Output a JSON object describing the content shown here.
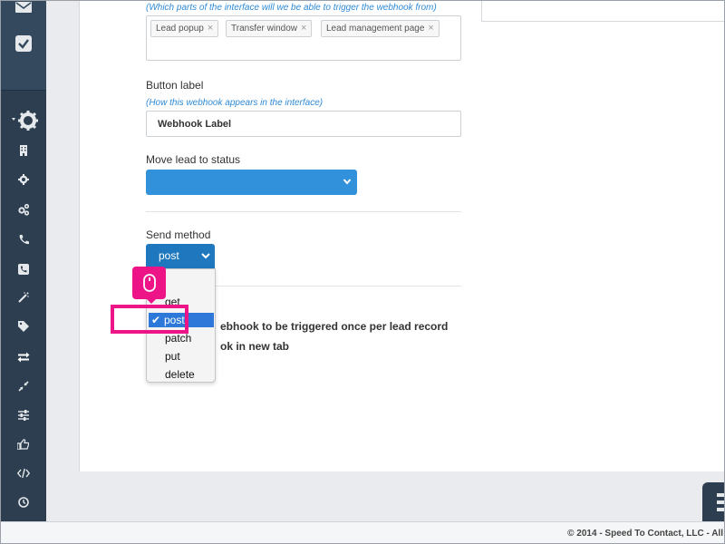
{
  "colors": {
    "sidebar": "#2c3e50",
    "accent": "#3191da",
    "highlight": "#ec1486"
  },
  "sidebar": {
    "icons": [
      "envelope-icon",
      "checkbox-icon",
      "gear-icon",
      "building-icon",
      "cog-icon",
      "cogs-icon",
      "phone-icon",
      "phone-square-icon",
      "magic-wand-icon",
      "tag-icon",
      "exchange-icon",
      "compress-icon",
      "sliders-icon",
      "thumbs-up-icon",
      "code-icon",
      "clock-icon"
    ]
  },
  "form": {
    "trigger_hint": "(Which parts of the interface will we be able to trigger the webhook from)",
    "trigger_tags": [
      "Lead popup",
      "Transfer window",
      "Lead management page"
    ],
    "tag_remove": "×",
    "button_label_title": "Button label",
    "button_label_hint": "(How this webhook appears in the interface)",
    "button_label_value": "Webhook Label",
    "move_status_title": "Move lead to status",
    "send_method_title": "Send method",
    "send_method_value": "post",
    "option_once_fragment": "ebhook to be triggered once per lead record",
    "option_newtab_fragment": "ok in new tab"
  },
  "dropdown": {
    "options": [
      "get",
      "post",
      "patch",
      "put",
      "delete"
    ],
    "selected": "post",
    "check": "✔"
  },
  "footer": {
    "copyright": "© 2014 - Speed To Contact, LLC - All"
  }
}
